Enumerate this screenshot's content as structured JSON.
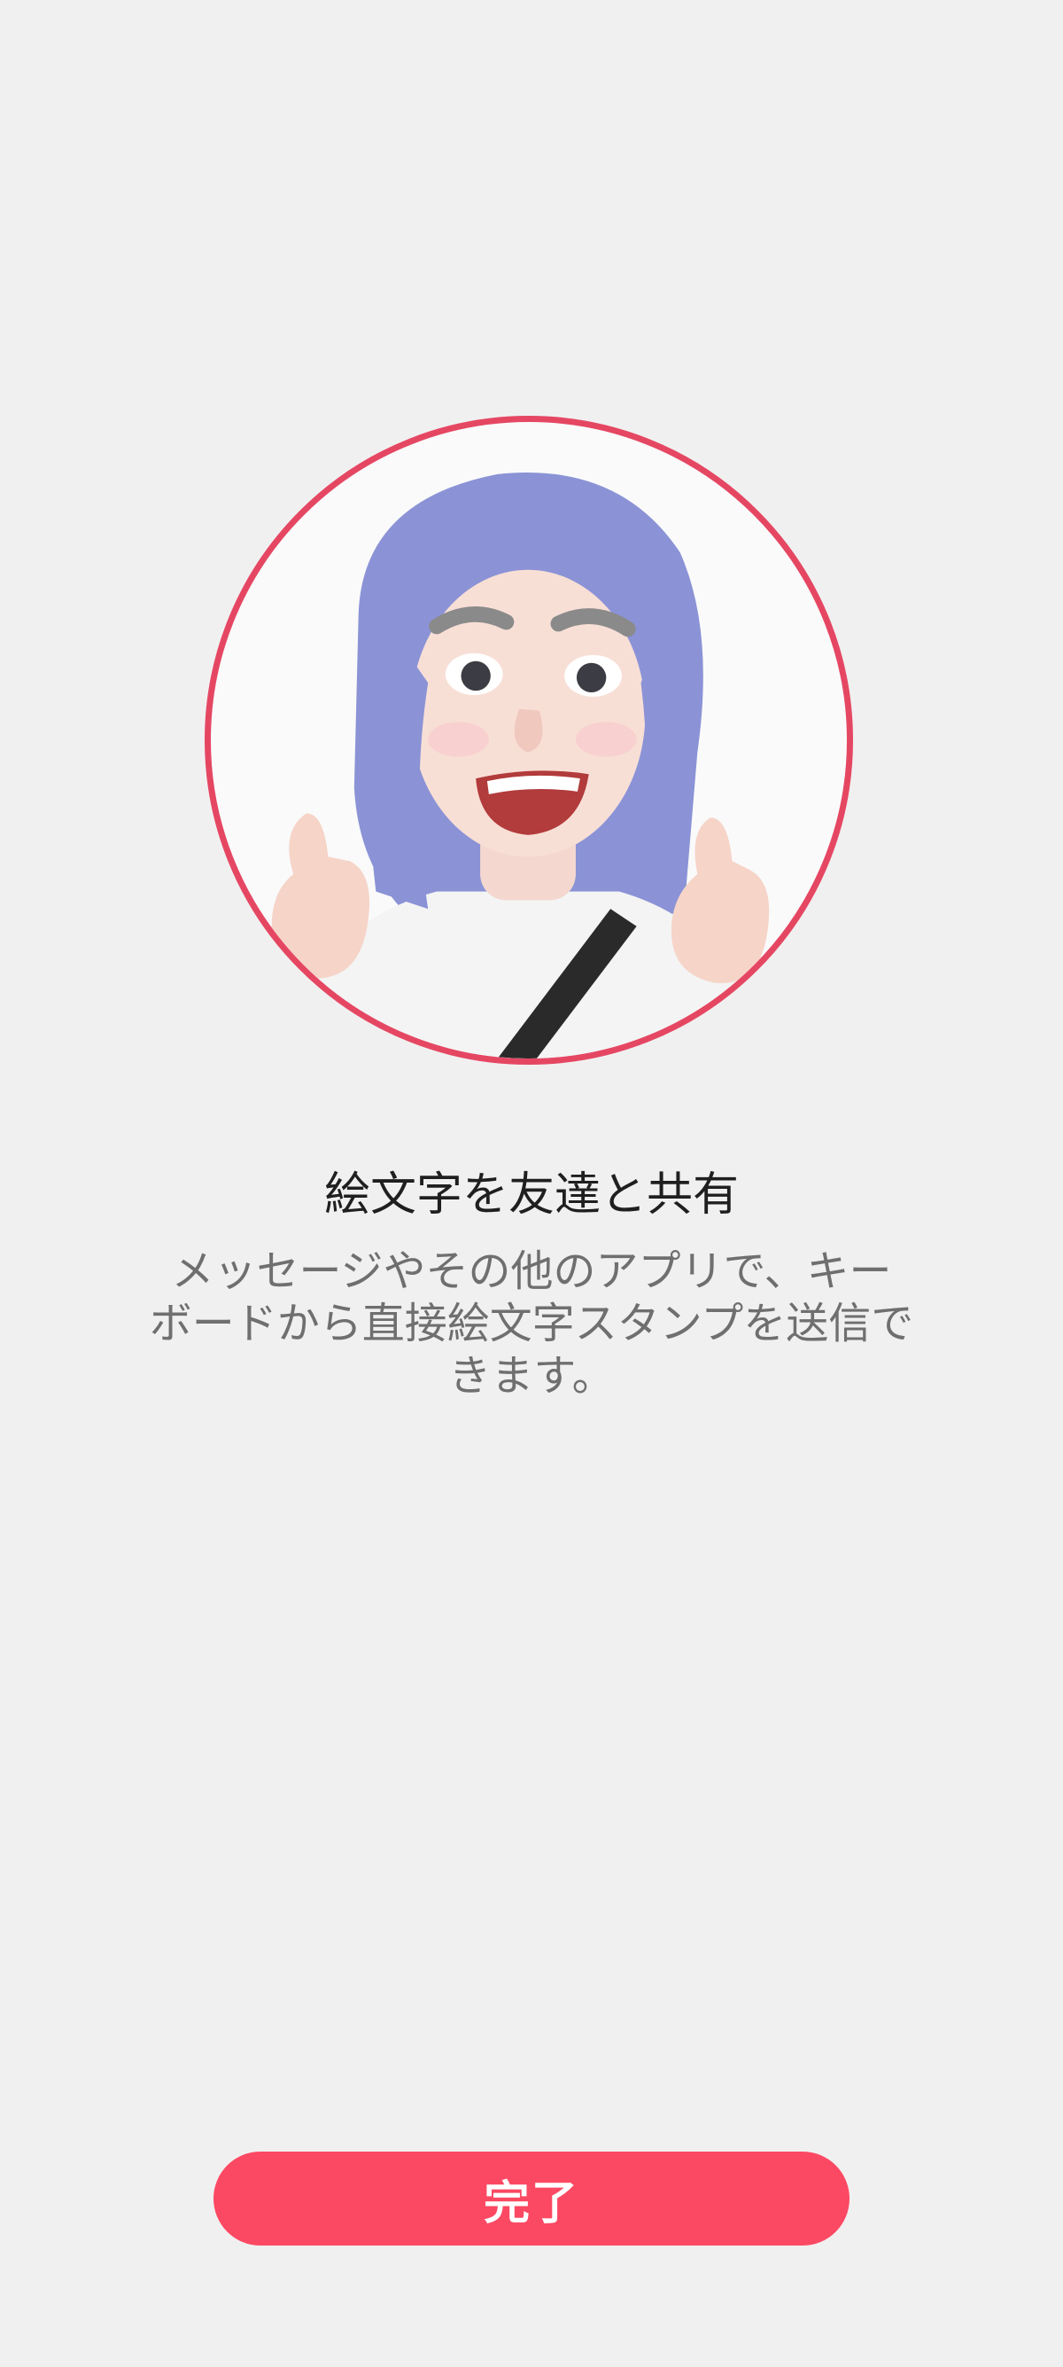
{
  "avatar": {
    "icon": "ar-emoji-avatar-thumbs-up",
    "ring_color": "#e54763",
    "hair_color": "#8b93d6"
  },
  "content": {
    "title": "絵文字を友達と共有",
    "description_lines": [
      "メッセージやその他のアプリで、キー",
      "ボードから直接絵文字スタンプを送信で",
      "きます。"
    ]
  },
  "footer": {
    "done_label": "完了",
    "button_color": "#fc4963"
  }
}
